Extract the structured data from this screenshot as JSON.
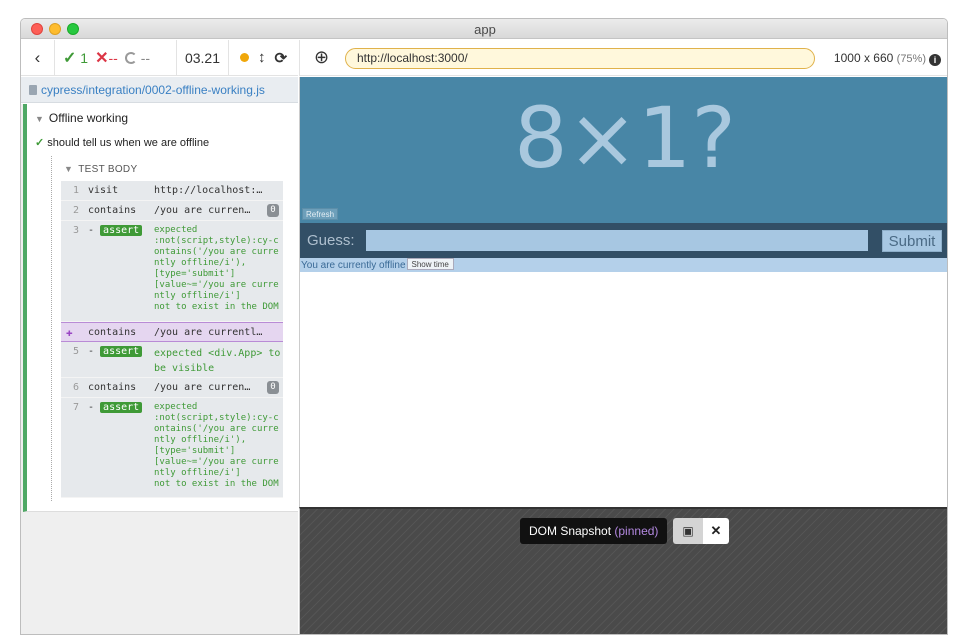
{
  "window": {
    "title": "app"
  },
  "runner": {
    "back_icon": "‹",
    "passed_icon": "✓",
    "passed": "1",
    "failed_icon": "✕",
    "failed": "--",
    "pending": "--",
    "duration": "03.21",
    "controls": {
      "auto_scroll_icon": "↕",
      "reload_icon": "⟳"
    }
  },
  "spec": {
    "path": "cypress/integration/0002-offline-working.js"
  },
  "reporter": {
    "suite_title": "Offline working",
    "test_title": "should tell us when we are offline",
    "body_title": "TEST BODY",
    "commands": [
      {
        "num": "1",
        "name": "visit",
        "message": "http://localhost:3…"
      },
      {
        "num": "2",
        "name": "contains",
        "message": "/you are current…",
        "badge": "0"
      },
      {
        "num": "3",
        "name": "- assert",
        "message": "expected\n:not(script,style):cy-contains('/you are currently offline/i'),\n[type='submit']\n[value~='/you are currently offline/i']\nnot to exist in the DOM"
      },
      {
        "num": "",
        "name": "contains",
        "message": "/you are currently…"
      },
      {
        "num": "5",
        "name": "- assert",
        "message": "expected <div.App> to be visible"
      },
      {
        "num": "6",
        "name": "contains",
        "message": "/you are current…",
        "badge": "0"
      },
      {
        "num": "7",
        "name": "- assert",
        "message": "expected\n:not(script,style):cy-contains('/you are currently offline/i'),\n[type='submit']\n[value~='/you are currently offline/i']\nnot to exist in the DOM"
      }
    ]
  },
  "browser": {
    "url": "http://localhost:3000/",
    "viewport": "1000 x 660",
    "scale": "(75%)"
  },
  "app": {
    "hero_text": "8×1?",
    "refresh_label": "Refresh",
    "guess_label": "Guess:",
    "guess_value": "",
    "submit_label": "Submit",
    "status_text": "You are currently offline",
    "show_time_label": "Show time"
  },
  "snapshot": {
    "label": "DOM Snapshot",
    "pinned_label": "(pinned)",
    "close_icon": "✕"
  }
}
